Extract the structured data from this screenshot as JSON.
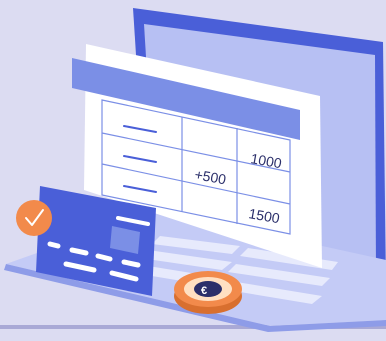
{
  "sheet": {
    "values": {
      "delta": "+500",
      "top": "1000",
      "bottom": "1500"
    }
  },
  "icons": {
    "coin": "euro-coin-icon",
    "badge": "check-badge-icon",
    "card": "credit-card-icon",
    "device": "laptop-icon"
  },
  "colors": {
    "background": "#dcdcf2",
    "laptop": "#4a5fd8",
    "screen": "#b7c0f3",
    "accent": "#f28a4b",
    "sheet_header": "#7b8fe6"
  }
}
